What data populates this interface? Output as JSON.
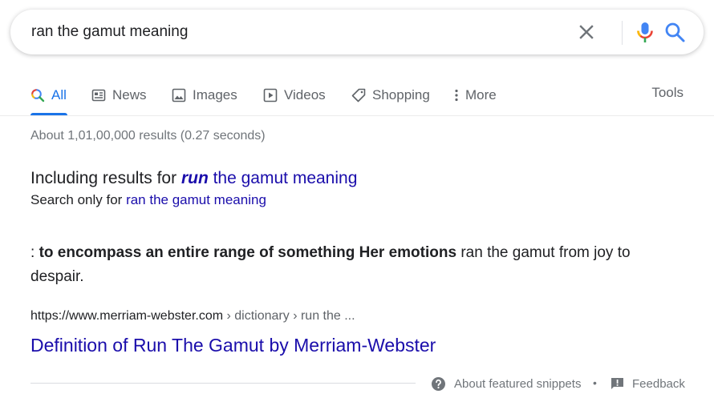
{
  "search": {
    "query": "ran the gamut meaning"
  },
  "tabs": [
    {
      "label": "All",
      "icon": "search-icon",
      "active": true
    },
    {
      "label": "News",
      "icon": "news-icon"
    },
    {
      "label": "Images",
      "icon": "image-icon"
    },
    {
      "label": "Videos",
      "icon": "video-icon"
    },
    {
      "label": "Shopping",
      "icon": "tag-icon"
    },
    {
      "label": "More",
      "icon": "more-vert-icon"
    }
  ],
  "tools_label": "Tools",
  "result_stats": "About 1,01,00,000 results (0.27 seconds)",
  "spelling": {
    "including_prefix": "Including results for ",
    "corrected_word": "run",
    "corrected_rest": " the gamut meaning",
    "search_only_prefix": "Search only for ",
    "original_query": "ran the gamut meaning"
  },
  "snippet": {
    "prefix": ": ",
    "bold": "to encompass an entire range of something Her emotions",
    "rest": " ran the gamut from joy to despair."
  },
  "result": {
    "site": "https://www.merriam-webster.com",
    "breadcrumbs": " › dictionary › run the ...",
    "title": "Definition of Run The Gamut by Merriam-Webster"
  },
  "footer": {
    "about_label": "About featured snippets",
    "separator": "•",
    "feedback_label": "Feedback"
  },
  "colors": {
    "accent": "#1a73e8",
    "link": "#1a0dab",
    "muted": "#70757a"
  }
}
